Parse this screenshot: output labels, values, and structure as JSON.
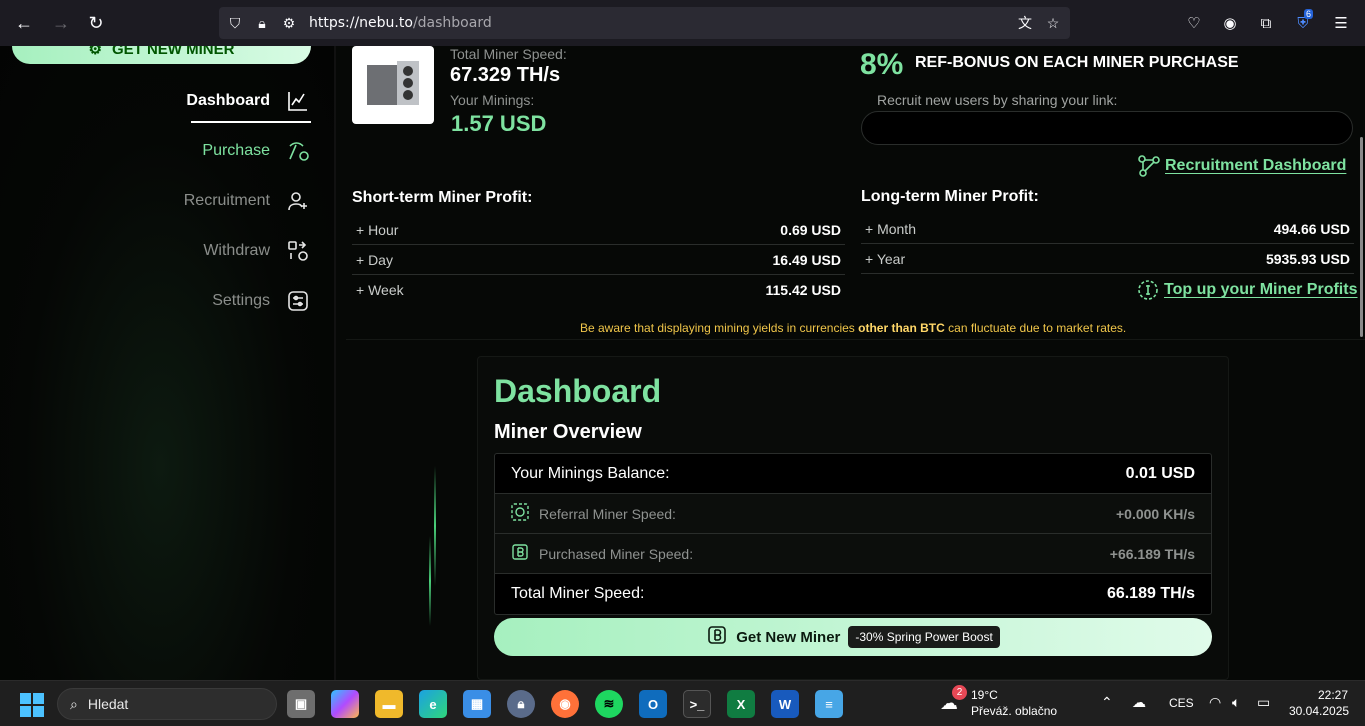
{
  "browser": {
    "url_host": "https://nebu.to",
    "url_path": "/dashboard",
    "extension_badge": "6"
  },
  "sidebar": {
    "get_new_miner_label": "GET NEW MINER",
    "items": [
      {
        "label": "Dashboard",
        "icon": "chart-line-icon",
        "state": "active"
      },
      {
        "label": "Purchase",
        "icon": "pickaxe-icon",
        "state": "highlight"
      },
      {
        "label": "Recruitment",
        "icon": "add-user-icon",
        "state": "normal"
      },
      {
        "label": "Withdraw",
        "icon": "withdraw-icon",
        "state": "normal"
      },
      {
        "label": "Settings",
        "icon": "settings-sliders-icon",
        "state": "normal"
      }
    ]
  },
  "header": {
    "total_speed_label": "Total Miner Speed:",
    "total_speed_value": "67.329 TH/s",
    "minings_label": "Your Minings:",
    "minings_value": "1.57 USD",
    "ref_percent": "8%",
    "ref_text": "REF-BONUS ON EACH MINER PURCHASE",
    "recruit_label": "Recruit new users by sharing your link:",
    "recruit_link_value": "",
    "recruitment_dashboard_link": "Recruitment Dashboard"
  },
  "short_term": {
    "title": "Short-term Miner Profit:",
    "rows": [
      {
        "label": "+ Hour",
        "value": "0.69 USD"
      },
      {
        "label": "+ Day",
        "value": "16.49 USD"
      },
      {
        "label": "+ Week",
        "value": "115.42 USD"
      }
    ]
  },
  "long_term": {
    "title": "Long-term Miner Profit:",
    "rows": [
      {
        "label": "+ Month",
        "value": "494.66 USD"
      },
      {
        "label": "+ Year",
        "value": "5935.93 USD"
      }
    ],
    "top_up_link": "Top up your Miner Profits"
  },
  "warning": {
    "before": "Be aware that displaying mining yields in currencies ",
    "bold": "other than BTC",
    "after": " can fluctuate due to market rates."
  },
  "dashboard": {
    "title": "Dashboard",
    "subtitle": "Miner Overview",
    "rows": {
      "balance_label": "Your Minings Balance:",
      "balance_value": "0.01 USD",
      "referral_label": "Referral Miner Speed:",
      "referral_value": "+0.000 KH/s",
      "purchased_label": "Purchased Miner Speed:",
      "purchased_value": "+66.189 TH/s",
      "total_label": "Total Miner Speed:",
      "total_value": "66.189 TH/s"
    },
    "get_miner_label": "Get New Miner",
    "boost_badge": "-30% Spring Power Boost"
  },
  "taskbar": {
    "search_placeholder": "Hledat",
    "weather_badge": "2",
    "weather_temp": "19°C",
    "weather_desc": "Převáž. oblačno",
    "language": "CES",
    "time": "22:27",
    "date": "30.04.2025"
  },
  "colors": {
    "accent_green": "#7ee2a0",
    "warning_yellow": "#f0c64a"
  }
}
